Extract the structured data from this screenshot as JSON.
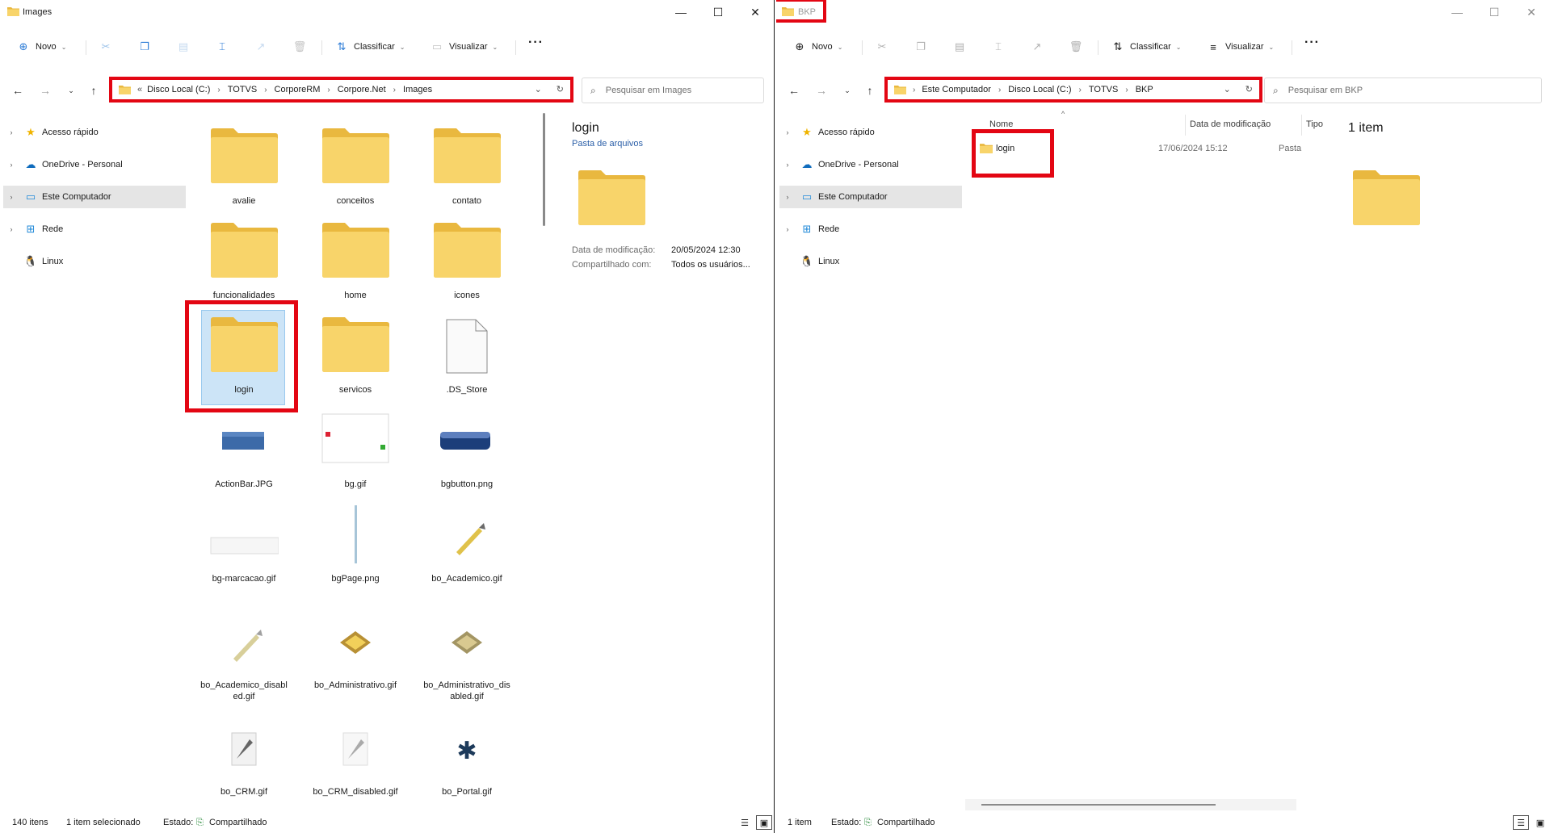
{
  "left": {
    "title": "Images",
    "toolbar": {
      "new_label": "Novo",
      "sort_label": "Classificar",
      "view_label": "Visualizar",
      "more": "···"
    },
    "breadcrumb": {
      "prefix": "«",
      "items": [
        "Disco Local (C:)",
        "TOTVS",
        "CorporeRM",
        "Corpore.Net",
        "Images"
      ]
    },
    "search_placeholder": "Pesquisar em Images",
    "sidebar": [
      "Acesso rápido",
      "OneDrive - Personal",
      "Este Computador",
      "Rede",
      "Linux"
    ],
    "files": [
      {
        "label": "avalie",
        "kind": "folder"
      },
      {
        "label": "conceitos",
        "kind": "folder"
      },
      {
        "label": "contato",
        "kind": "folder"
      },
      {
        "label": "funcionalidades",
        "kind": "folder"
      },
      {
        "label": "home",
        "kind": "folder"
      },
      {
        "label": "icones",
        "kind": "folder"
      },
      {
        "label": "login",
        "kind": "folder",
        "selected": true
      },
      {
        "label": "servicos",
        "kind": "folder"
      },
      {
        "label": ".DS_Store",
        "kind": "file"
      },
      {
        "label": "ActionBar.JPG",
        "kind": "image"
      },
      {
        "label": "bg.gif",
        "kind": "image"
      },
      {
        "label": "bgbutton.png",
        "kind": "image"
      },
      {
        "label": "bg-marcacao.gif",
        "kind": "image"
      },
      {
        "label": "bgPage.png",
        "kind": "image"
      },
      {
        "label": "bo_Academico.gif",
        "kind": "image"
      },
      {
        "label": "bo_Academico_disabled.gif",
        "kind": "image"
      },
      {
        "label": "bo_Administrativo.gif",
        "kind": "image"
      },
      {
        "label": "bo_Administrativo_disabled.gif",
        "kind": "image"
      },
      {
        "label": "bo_CRM.gif",
        "kind": "image"
      },
      {
        "label": "bo_CRM_disabled.gif",
        "kind": "image"
      },
      {
        "label": "bo_Portal.gif",
        "kind": "image"
      }
    ],
    "details": {
      "name": "login",
      "type": "Pasta de arquivos",
      "modified_label": "Data de modificação:",
      "modified_value": "20/05/2024 12:30",
      "shared_label": "Compartilhado com:",
      "shared_value": "Todos os usuários..."
    },
    "status": {
      "count": "140 itens",
      "selected": "1 item selecionado",
      "state_label": "Estado:",
      "state_value": "Compartilhado"
    }
  },
  "right": {
    "title": "BKP",
    "toolbar": {
      "new_label": "Novo",
      "sort_label": "Classificar",
      "view_label": "Visualizar",
      "more": "···"
    },
    "breadcrumb": {
      "items": [
        "Este Computador",
        "Disco Local (C:)",
        "TOTVS",
        "BKP"
      ]
    },
    "search_placeholder": "Pesquisar em BKP",
    "sidebar": [
      "Acesso rápido",
      "OneDrive - Personal",
      "Este Computador",
      "Rede",
      "Linux"
    ],
    "columns": [
      "Nome",
      "Data de modificação",
      "Tipo"
    ],
    "rows": [
      {
        "name": "login",
        "modified": "17/06/2024 15:12",
        "type": "Pasta"
      }
    ],
    "details": {
      "summary": "1 item"
    },
    "status": {
      "count": "1 item",
      "state_label": "Estado:",
      "state_value": "Compartilhado"
    }
  },
  "colors": {
    "highlight": "#e30613",
    "folder": "#f8d46a",
    "folder_dark": "#e9b83f",
    "selection": "#cce4f7"
  }
}
